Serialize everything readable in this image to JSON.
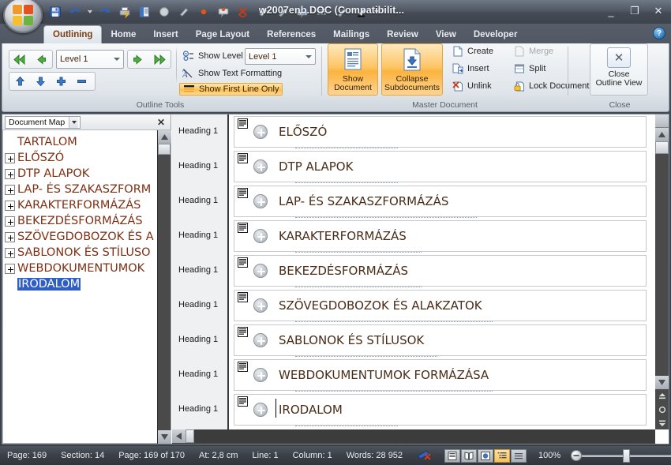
{
  "window": {
    "title": "w2007enb.DOC (Compatibilit...",
    "minimize": "_",
    "maximize": "❐",
    "close": "✕",
    "help": "?"
  },
  "quick_access": {
    "icons": [
      "save-icon",
      "undo-icon",
      "undo-dropdown",
      "redo-icon",
      "quick-print-icon",
      "print-preview-icon",
      "spelling-icon",
      "pen-icon",
      "red-dot-icon",
      "comment-icon",
      "reject-icon",
      "eraser-icon",
      "pen2-icon",
      "text-box-icon",
      "table-icon",
      "pen3-icon",
      "highlighter-icon",
      "qat-dropdown"
    ]
  },
  "tabs": [
    {
      "label": "Outlining",
      "active": true
    },
    {
      "label": "Home",
      "active": false
    },
    {
      "label": "Insert",
      "active": false
    },
    {
      "label": "Page Layout",
      "active": false
    },
    {
      "label": "References",
      "active": false
    },
    {
      "label": "Mailings",
      "active": false
    },
    {
      "label": "Review",
      "active": false
    },
    {
      "label": "View",
      "active": false
    },
    {
      "label": "Developer",
      "active": false
    }
  ],
  "ribbon": {
    "groups": [
      {
        "name": "Outline Tools",
        "label": "Outline Tools"
      },
      {
        "name": "Master Document",
        "label": "Master Document"
      },
      {
        "name": "Close",
        "label": "Close"
      }
    ],
    "outline_tools": {
      "promote_to_heading1": "«",
      "promote": "◄",
      "level_value": "Level 1",
      "demote": "►",
      "demote_to_body": "»",
      "move_up": "▲",
      "move_down": "▼",
      "expand": "+",
      "collapse": "−",
      "show_level_label": "Show Level",
      "show_level_value": "Level 1",
      "show_text_formatting": "Show Text Formatting",
      "show_first_line_only": "Show First Line Only"
    },
    "master_document": {
      "show_document": "Show\nDocument",
      "show_document_line1": "Show",
      "show_document_line2": "Document",
      "collapse_subdocuments_line1": "Collapse",
      "collapse_subdocuments_line2": "Subdocuments",
      "create": "Create",
      "merge": "Merge",
      "insert": "Insert",
      "split": "Split",
      "unlink": "Unlink",
      "lock_document": "Lock Document"
    },
    "close_group": {
      "close_outline_view_line1": "Close",
      "close_outline_view_line2": "Outline View",
      "icon": "✕"
    }
  },
  "document_map": {
    "panel_title": "Document Map",
    "close": "✕",
    "items": [
      {
        "label": "TARTALOM",
        "expandable": false,
        "selected": false
      },
      {
        "label": "ELŐSZÓ",
        "expandable": true,
        "selected": false
      },
      {
        "label": "DTP ALAPOK",
        "expandable": true,
        "selected": false
      },
      {
        "label": "LAP- ÉS SZAKASZFORM",
        "expandable": true,
        "selected": false
      },
      {
        "label": "KARAKTERFORMÁZÁS",
        "expandable": true,
        "selected": false
      },
      {
        "label": "BEKEZDÉSFORMÁZÁS",
        "expandable": true,
        "selected": false
      },
      {
        "label": "SZÖVEGDOBOZOK ÉS A",
        "expandable": true,
        "selected": false
      },
      {
        "label": "SABLONOK ÉS STÍLUSO",
        "expandable": true,
        "selected": false
      },
      {
        "label": "WEBDOKUMENTUMOK",
        "expandable": true,
        "selected": false
      },
      {
        "label": "IRODALOM",
        "expandable": false,
        "selected": true
      }
    ]
  },
  "outline": {
    "style_label": "Heading 1",
    "rows": [
      {
        "style": "Heading 1",
        "text": "ELŐSZÓ",
        "caret": false
      },
      {
        "style": "Heading 1",
        "text": "DTP ALAPOK",
        "caret": false
      },
      {
        "style": "Heading 1",
        "text": "LAP- ÉS SZAKASZFORMÁZÁS",
        "caret": false
      },
      {
        "style": "Heading 1",
        "text": "KARAKTERFORMÁZÁS",
        "caret": false
      },
      {
        "style": "Heading 1",
        "text": "BEKEZDÉSFORMÁZÁS",
        "caret": false
      },
      {
        "style": "Heading 1",
        "text": "SZÖVEGDOBOZOK ÉS ALAKZATOK",
        "caret": false
      },
      {
        "style": "Heading 1",
        "text": "SABLONOK ÉS STÍLUSOK",
        "caret": false
      },
      {
        "style": "Heading 1",
        "text": "WEBDOKUMENTUMOK FORMÁZÁSA",
        "caret": false
      },
      {
        "style": "Heading 1",
        "text": "IRODALOM",
        "caret": true
      }
    ]
  },
  "status_bar": {
    "page": "Page: 169",
    "section": "Section: 14",
    "page_of": "Page: 169 of 170",
    "at": "At: 2,8 cm",
    "line": "Line: 1",
    "column": "Column: 1",
    "words": "Words: 28 952",
    "proofing_icon": "spelling-errors-icon",
    "views": [
      "print-layout-icon",
      "full-screen-reading-icon",
      "web-layout-icon",
      "outline-icon",
      "draft-icon"
    ],
    "active_view": "outline-icon",
    "zoom": "100%",
    "zoom_out": "−",
    "zoom_in": "+"
  },
  "colors": {
    "accent_orange": "#fbbe4f",
    "heading_text": "#4a2d18",
    "docmap_text": "#7e2f13",
    "selection_blue": "#2f5fc4",
    "chrome_dark": "#3b4048"
  }
}
